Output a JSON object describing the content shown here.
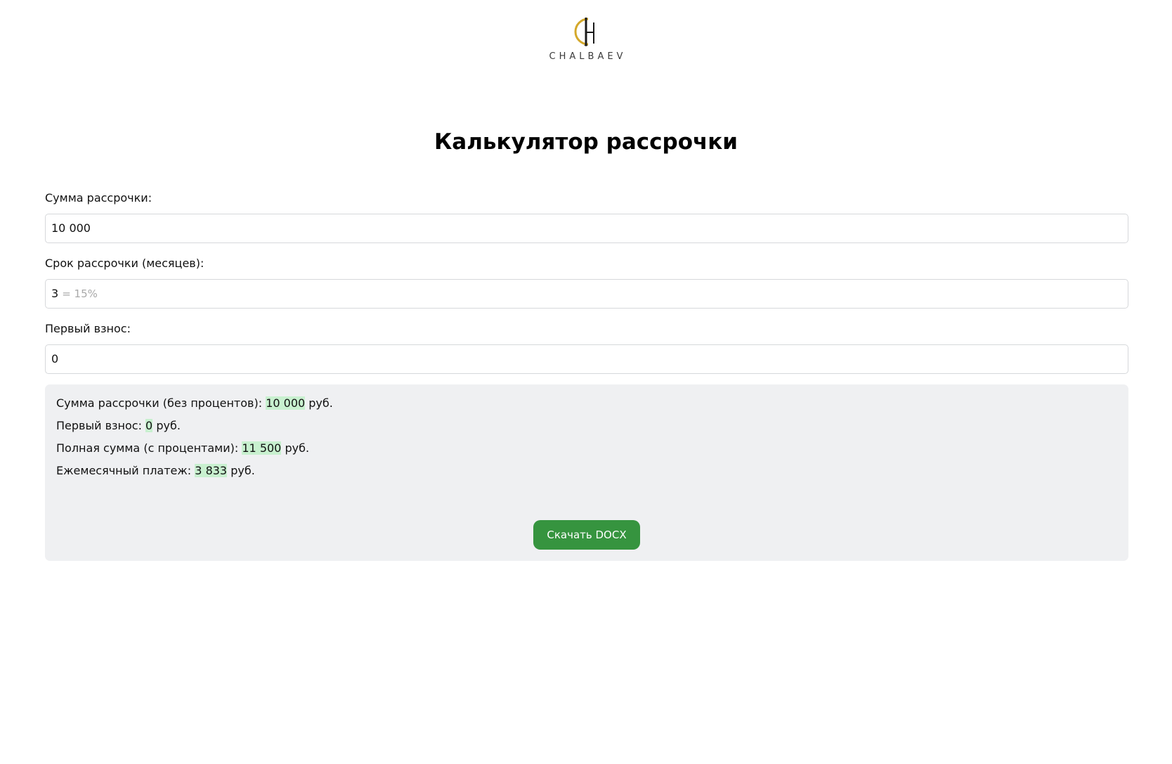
{
  "header": {
    "logo_name": "CHALBAEV",
    "logo_icon": "ch-monogram-logo-icon",
    "logo_colors": {
      "gold": "#d4a82a",
      "dark": "#1a1a1a"
    }
  },
  "page": {
    "title": "Калькулятор рассрочки"
  },
  "form": {
    "amount": {
      "label": "Сумма рассрочки:",
      "value": "10 000"
    },
    "term": {
      "label": "Срок рассрочки (месяцев):",
      "value": "3",
      "hint": "= 15%"
    },
    "down_payment": {
      "label": "Первый взнос:",
      "value": "0"
    }
  },
  "results": {
    "currency": "руб.",
    "amount_no_interest": {
      "label": "Сумма рассрочки (без процентов):",
      "value": "10 000"
    },
    "down_payment": {
      "label": "Первый взнос:",
      "value": "0"
    },
    "total_with_interest": {
      "label": "Полная сумма (с процентами):",
      "value": "11 500"
    },
    "monthly_payment": {
      "label": "Ежемесячный платеж:",
      "value": "3 833"
    },
    "download_label": "Скачать DOCX"
  },
  "colors": {
    "accent_button": "#36943f",
    "highlight": "#c8f0cf",
    "panel_background": "#eff0f2"
  }
}
